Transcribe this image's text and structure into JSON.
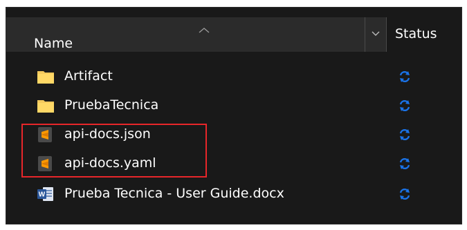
{
  "header": {
    "name_label": "Name",
    "status_label": "Status"
  },
  "files": [
    {
      "name": "Artifact",
      "type": "folder",
      "status": "sync-icon"
    },
    {
      "name": "PruebaTecnica",
      "type": "folder",
      "status": "sync-icon"
    },
    {
      "name": "api-docs.json",
      "type": "sublime",
      "status": "sync-icon"
    },
    {
      "name": "api-docs.yaml",
      "type": "sublime",
      "status": "sync-icon"
    },
    {
      "name": "Prueba Tecnica - User Guide.docx",
      "type": "word",
      "status": "sync-icon"
    }
  ],
  "colors": {
    "background": "#191919",
    "header": "#2b2b2b",
    "folder": "#f4c95d",
    "sync": "#1a73e8",
    "highlight": "#e8262a",
    "word": "#2b579a",
    "sublime": "#ff9800"
  }
}
